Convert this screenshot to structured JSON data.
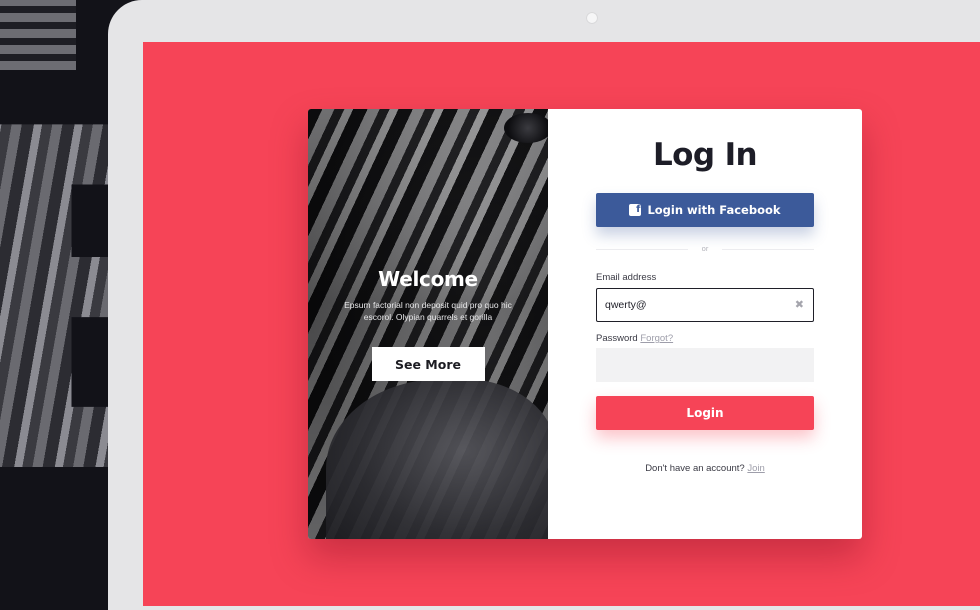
{
  "card": {
    "left": {
      "title": "Welcome",
      "body": "Epsum factorial non deposit quid pro quo hic escorol. Olypian quarrels et gorilla",
      "button_label": "See More"
    },
    "right": {
      "title": "Log In",
      "facebook_button_label": "Login with Facebook",
      "divider_text": "or",
      "email_label": "Email address",
      "email_value": "qwerty@",
      "password_label": "Password",
      "forgot_label": "Forgot?",
      "password_value": "",
      "login_button_label": "Login",
      "signup_prompt": "Don't have an account?",
      "join_label": "Join"
    }
  },
  "colors": {
    "accent": "#f64457",
    "facebook": "#3c5a9a",
    "frame": "#e5e5e7"
  },
  "icons": [
    "facebook-icon",
    "clear-icon",
    "camera-icon"
  ]
}
